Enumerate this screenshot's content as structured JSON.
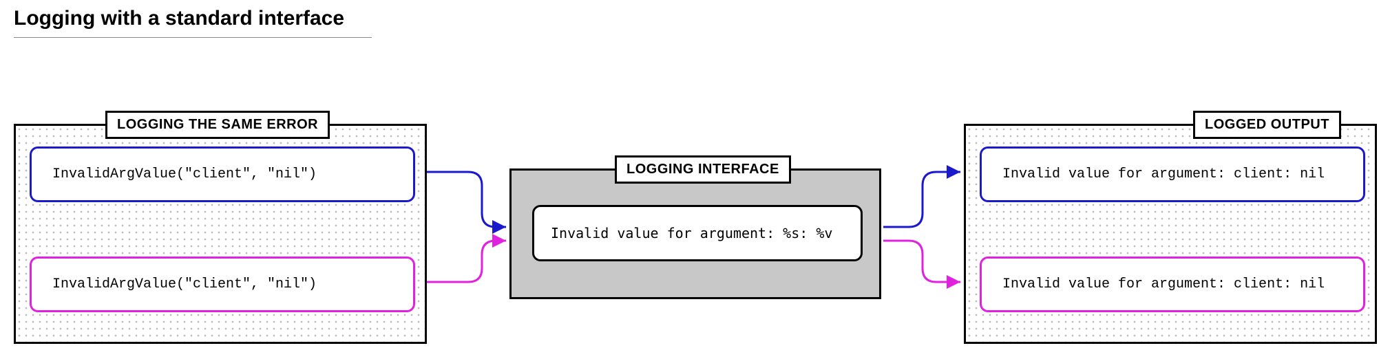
{
  "title": "Logging with a standard interface",
  "left": {
    "label": "LOGGING THE SAME ERROR",
    "box1": "InvalidArgValue(\"client\", \"nil\")",
    "box2": "InvalidArgValue(\"client\", \"nil\")"
  },
  "center": {
    "label": "LOGGING INTERFACE",
    "box": "Invalid value for argument: %s: %v"
  },
  "right": {
    "label": "LOGGED OUTPUT",
    "box1": "Invalid value for argument: client: nil",
    "box2": "Invalid value for argument: client: nil"
  },
  "colors": {
    "blue": "#1a1acc",
    "magenta": "#e022e0"
  }
}
